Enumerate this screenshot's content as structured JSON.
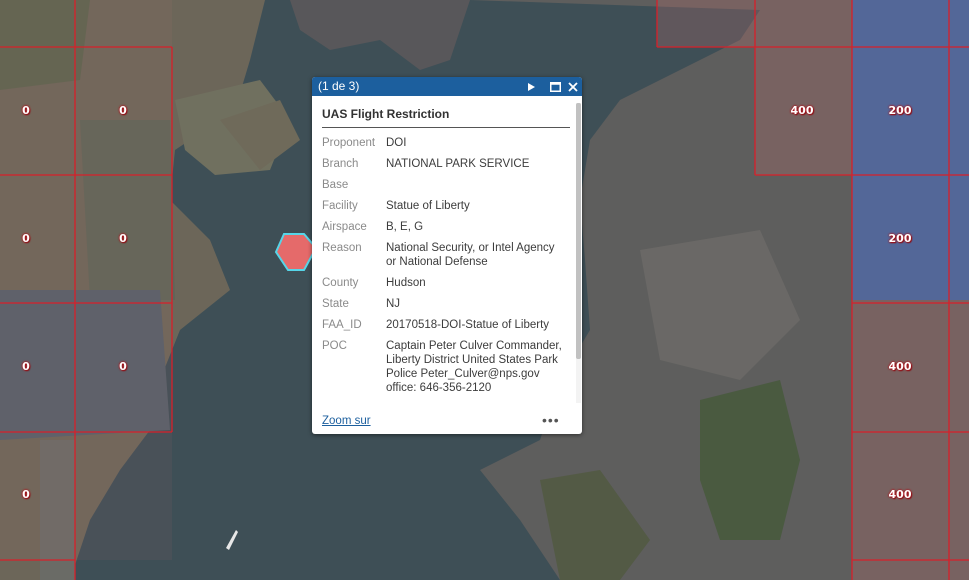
{
  "map": {
    "grid_labels": [
      {
        "col": 0,
        "row": 0,
        "text": "0"
      },
      {
        "col": 1,
        "row": 0,
        "text": "0"
      },
      {
        "col": 0,
        "row": 1,
        "text": "0"
      },
      {
        "col": 1,
        "row": 1,
        "text": "0"
      },
      {
        "col": 0,
        "row": 2,
        "text": "0"
      },
      {
        "col": 1,
        "row": 2,
        "text": "0"
      },
      {
        "col": 0,
        "row": 3,
        "text": "0"
      },
      {
        "col": 8,
        "row": 0,
        "text": "400"
      },
      {
        "col": 9,
        "row": 0,
        "text": "200"
      },
      {
        "col": 9,
        "row": 1,
        "text": "200"
      },
      {
        "col": 9,
        "row": 2,
        "text": "400"
      },
      {
        "col": 9,
        "row": 3,
        "text": "400"
      }
    ],
    "colors": {
      "grid_line": "#d8202a",
      "water": "#3f4f55",
      "restricted_zone_fill": "#e56a6a",
      "restricted_zone_stroke": "#56d5e8",
      "blue_zone": "#4a6fc8"
    }
  },
  "popup": {
    "counter": "(1 de 3)",
    "title": "UAS Flight Restriction",
    "attributes": [
      {
        "label": "Proponent",
        "value": "DOI"
      },
      {
        "label": "Branch",
        "value": "NATIONAL PARK SERVICE"
      },
      {
        "label": "Base",
        "value": ""
      },
      {
        "label": "Facility",
        "value": "Statue of Liberty"
      },
      {
        "label": "Airspace",
        "value": "B, E, G"
      },
      {
        "label": "Reason",
        "value": "National Security, or Intel Agency or National Defense"
      },
      {
        "label": "County",
        "value": "Hudson"
      },
      {
        "label": "State",
        "value": "NJ"
      },
      {
        "label": "FAA_ID",
        "value": "20170518-DOI-Statue of Liberty"
      },
      {
        "label": "POC",
        "value": "Captain Peter Culver Commander, Liberty District United States Park Police Peter_Culver@nps.gov office: 646-356-2120"
      }
    ],
    "zoom_link": "Zoom sur",
    "more_icon": "•••",
    "header_color": "#1c5f9e"
  }
}
